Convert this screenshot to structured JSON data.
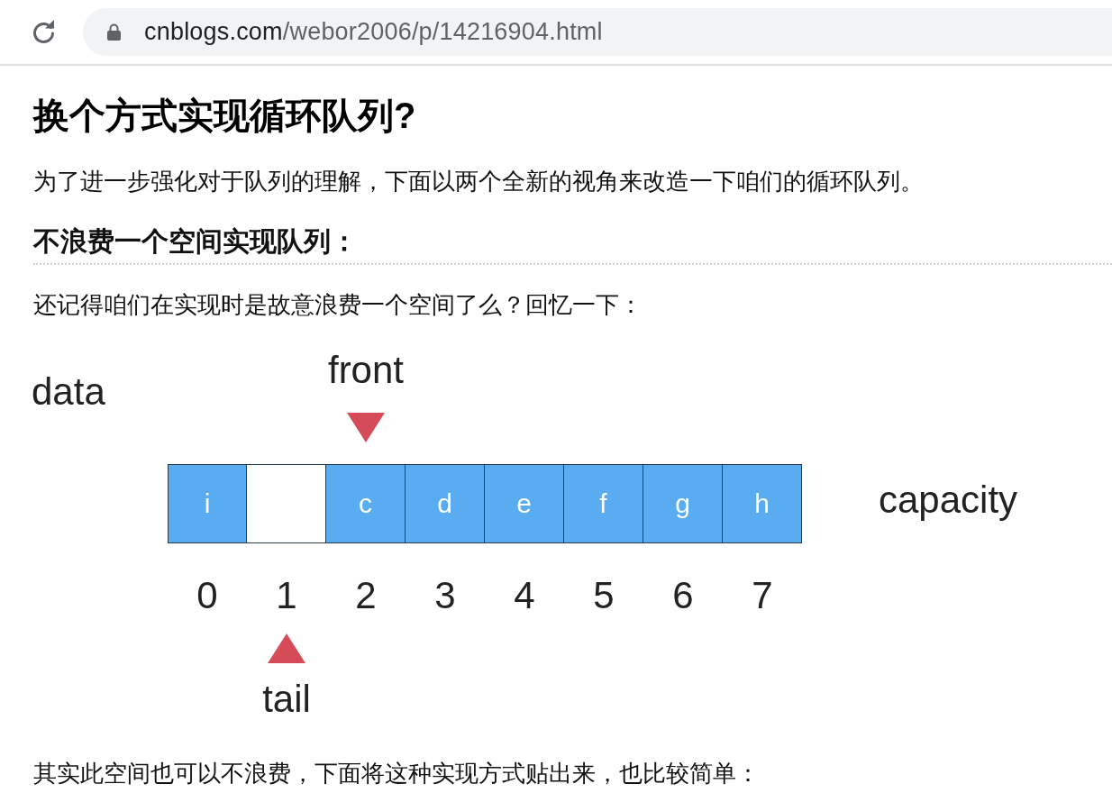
{
  "browser": {
    "url": {
      "host": "cnblogs.com",
      "path": "/webor2006/p/14216904.html"
    }
  },
  "article": {
    "title": "换个方式实现循环队列?",
    "intro": "为了进一步强化对于队列的理解，下面以两个全新的视角来改造一下咱们的循环队列。",
    "section_heading": "不浪费一个空间实现队列：",
    "recall_text": "还记得咱们在实现时是故意浪费一个空间了么？回忆一下：",
    "diagram": {
      "array_label": "data",
      "capacity_label": "capacity",
      "cells": [
        {
          "value": "i",
          "index": "0",
          "filled": true
        },
        {
          "index": "1",
          "filled": false,
          "pointer": {
            "kind": "below",
            "label": "tail"
          }
        },
        {
          "value": "c",
          "index": "2",
          "filled": true,
          "pointer": {
            "kind": "above",
            "label": "front"
          }
        },
        {
          "value": "d",
          "index": "3",
          "filled": true
        },
        {
          "value": "e",
          "index": "4",
          "filled": true
        },
        {
          "value": "f",
          "index": "5",
          "filled": true
        },
        {
          "value": "g",
          "index": "6",
          "filled": true
        },
        {
          "value": "h",
          "index": "7",
          "filled": true
        }
      ]
    },
    "closing_text": "其实此空间也可以不浪费，下面将这种实现方式贴出来，也比较简单："
  }
}
